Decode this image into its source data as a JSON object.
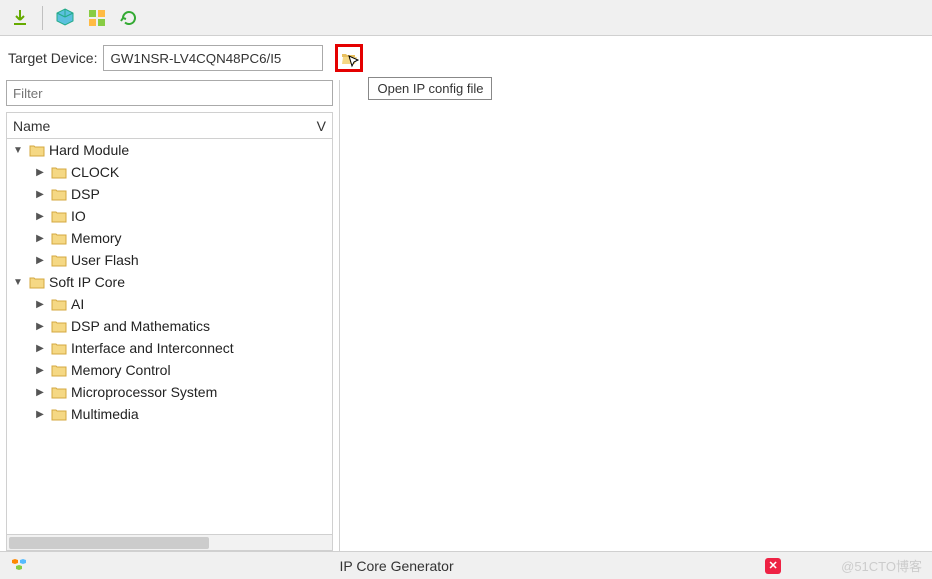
{
  "toolbar": {
    "icons": [
      "download-icon",
      "cube-icon",
      "grid-icon",
      "refresh-icon"
    ]
  },
  "target": {
    "label": "Target Device:",
    "value": "GW1NSR-LV4CQN48PC6/I5",
    "tooltip": "Open IP config file"
  },
  "filter": {
    "placeholder": "Filter"
  },
  "tree": {
    "header_name": "Name",
    "header_v": "V",
    "items": [
      {
        "label": "Hard Module",
        "depth": 0,
        "expanded": true
      },
      {
        "label": "CLOCK",
        "depth": 1,
        "expanded": false
      },
      {
        "label": "DSP",
        "depth": 1,
        "expanded": false
      },
      {
        "label": "IO",
        "depth": 1,
        "expanded": false
      },
      {
        "label": "Memory",
        "depth": 1,
        "expanded": false
      },
      {
        "label": "User Flash",
        "depth": 1,
        "expanded": false
      },
      {
        "label": "Soft IP Core",
        "depth": 0,
        "expanded": true
      },
      {
        "label": "AI",
        "depth": 1,
        "expanded": false
      },
      {
        "label": "DSP and Mathematics",
        "depth": 1,
        "expanded": false
      },
      {
        "label": "Interface and Interconnect",
        "depth": 1,
        "expanded": false
      },
      {
        "label": "Memory Control",
        "depth": 1,
        "expanded": false
      },
      {
        "label": "Microprocessor System",
        "depth": 1,
        "expanded": false
      },
      {
        "label": "Multimedia",
        "depth": 1,
        "expanded": false
      }
    ]
  },
  "status": {
    "title": "IP Core Generator",
    "watermark": "@51CTO博客"
  }
}
